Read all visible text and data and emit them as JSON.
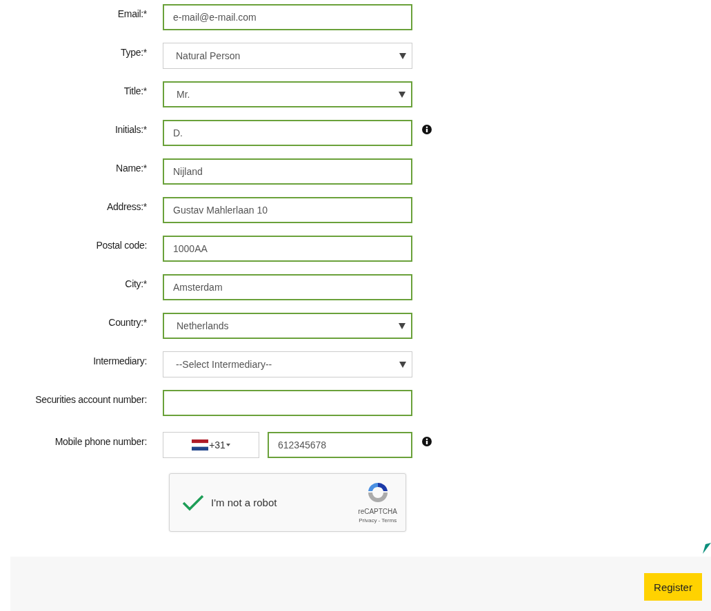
{
  "form": {
    "fields": [
      {
        "label": "Email:*",
        "kind": "text",
        "value": "e-mail@e-mail.com",
        "valid": true,
        "info": false
      },
      {
        "label": "Type:*",
        "kind": "select",
        "value": "Natural Person",
        "valid": false,
        "info": false
      },
      {
        "label": "Title:*",
        "kind": "select",
        "value": "Mr.",
        "valid": true,
        "info": false
      },
      {
        "label": "Initials:*",
        "kind": "text",
        "value": "D.",
        "valid": true,
        "info": true
      },
      {
        "label": "Name:*",
        "kind": "text",
        "value": "Nijland",
        "valid": true,
        "info": false
      },
      {
        "label": "Address:*",
        "kind": "text",
        "value": "Gustav Mahlerlaan 10",
        "valid": true,
        "info": false
      },
      {
        "label": "Postal code:",
        "kind": "text",
        "value": "1000AA",
        "valid": true,
        "info": false
      },
      {
        "label": "City:*",
        "kind": "text",
        "value": "Amsterdam",
        "valid": true,
        "info": false
      },
      {
        "label": "Country:*",
        "kind": "select",
        "value": "Netherlands",
        "valid": true,
        "info": false
      },
      {
        "label": "Intermediary:",
        "kind": "select",
        "value": "--Select Intermediary--",
        "valid": false,
        "info": false
      },
      {
        "label": "Securities account number:",
        "kind": "text",
        "valid": true,
        "info": false
      },
      {
        "label": "Mobile phone number:",
        "kind": "phone",
        "code": "+31",
        "value": "612345678",
        "valid": true,
        "info": true
      }
    ]
  },
  "captcha": {
    "label": "I'm not a robot",
    "checked": true,
    "brand": "reCAPTCHA",
    "links": "Privacy - Terms"
  },
  "footer": {
    "button": "Register"
  }
}
